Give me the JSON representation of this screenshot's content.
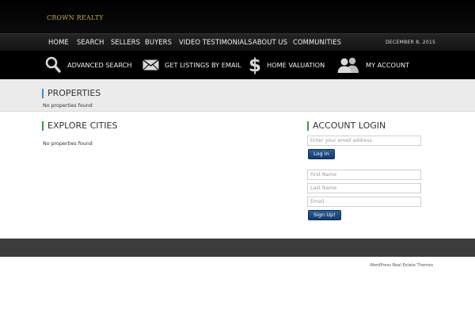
{
  "brand": {
    "logo_text": "CROWN REALTY",
    "accent": "#c9a54a"
  },
  "nav": {
    "items": [
      "HOME",
      "SEARCH",
      "SELLERS",
      "BUYERS",
      "VIDEO TESTIMONIALS",
      "ABOUT US",
      "COMMUNITIES"
    ],
    "date": "DECEMBER 8, 2015"
  },
  "quick_links": {
    "advanced_search": {
      "label": "ADVANCED SEARCH",
      "icon": "search-icon"
    },
    "listings_email": {
      "label": "GET LISTINGS BY EMAIL",
      "icon": "envelope-icon"
    },
    "home_valuation": {
      "label": "HOME VALUATION",
      "icon": "dollar-icon"
    },
    "my_account": {
      "label": "MY ACCOUNT",
      "icon": "users-icon"
    }
  },
  "properties": {
    "title": "PROPERTIES",
    "empty": "No properties found"
  },
  "explore": {
    "title": "EXPLORE CITIES",
    "empty": "No properties found"
  },
  "account_login": {
    "title": "ACCOUNT LOGIN",
    "email_placeholder": "Enter your email address",
    "login_button": "Log In",
    "first_name_placeholder": "First Name",
    "last_name_placeholder": "Last Name",
    "signup_email_placeholder": "Email",
    "signup_button": "Sign Up!"
  },
  "footer": {
    "link": "WordPress Real Estate Themes"
  },
  "colors": {
    "title_blue": "#3a8fd1",
    "title_green": "#3aa14a",
    "button": "#1d4a80"
  }
}
